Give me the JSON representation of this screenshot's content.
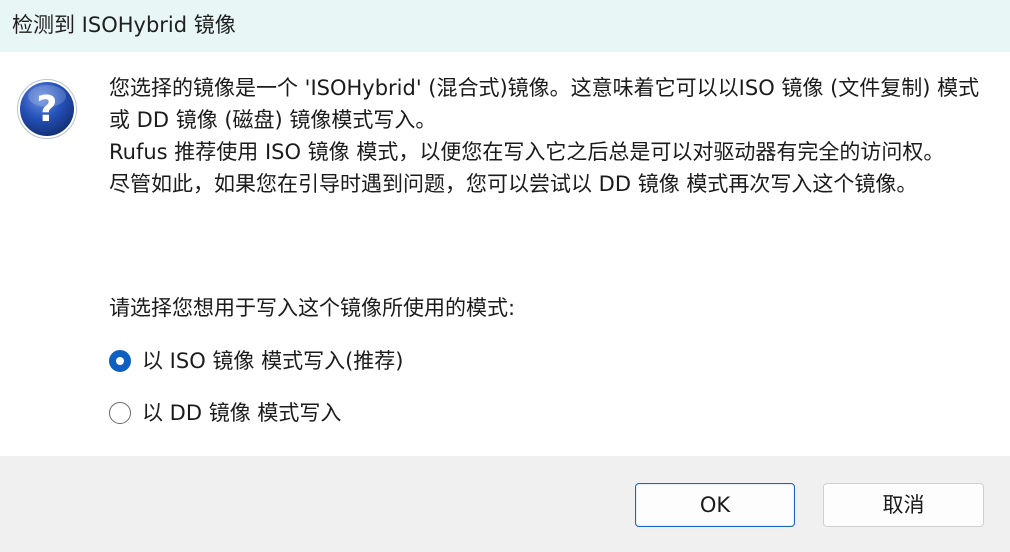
{
  "window": {
    "title": "检测到 ISOHybrid 镜像"
  },
  "icon": {
    "name": "question-icon",
    "glyph": "?",
    "color": "#1f4fa8"
  },
  "message": {
    "paragraphs": [
      "您选择的镜像是一个 'ISOHybrid' (混合式)镜像。这意味着它可以以ISO 镜像 (文件复制) 模式或 DD 镜像 (磁盘) 镜像模式写入。",
      "Rufus 推荐使用 ISO 镜像 模式，以便您在写入它之后总是可以对驱动器有完全的访问权。",
      "尽管如此，如果您在引导时遇到问题，您可以尝试以 DD 镜像 模式再次写入这个镜像。"
    ]
  },
  "prompt": "请选择您想用于写入这个镜像所使用的模式:",
  "options": [
    {
      "label": "以 ISO 镜像 模式写入(推荐)",
      "selected": true
    },
    {
      "label": "以 DD 镜像 模式写入",
      "selected": false
    }
  ],
  "buttons": {
    "ok_label": "OK",
    "cancel_label": "取消"
  },
  "colors": {
    "titlebar_bg": "#e8f6f6",
    "accent": "#0f5fc2",
    "footer_bg": "#f0f0f0"
  }
}
